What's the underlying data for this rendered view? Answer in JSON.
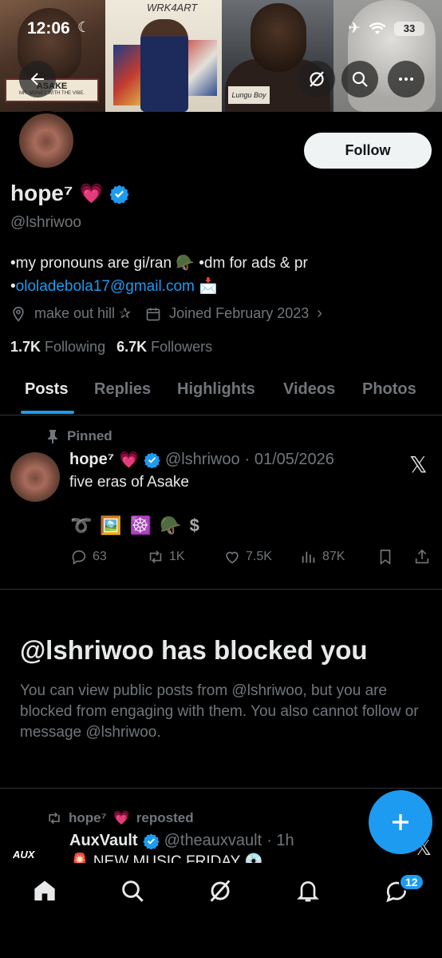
{
  "status_bar": {
    "time": "12:06",
    "battery": "33"
  },
  "banner": {
    "panel_texts": {
      "sign_line1": "ASAKE",
      "sign_line2": "MR. MONEY WITH THE VIBE.",
      "wall_text": "WRK4ART",
      "card_text": "Lungu Boy"
    }
  },
  "profile": {
    "display_name": "hope⁷",
    "name_emoji": "💗",
    "handle": "@lshriwoo",
    "follow_label": "Follow",
    "bio_line1": "•my pronouns are gi/ran 🪖 •dm for ads & pr",
    "bio_line2_prefix": "•",
    "bio_email": "ololadebola17@gmail.com",
    "bio_email_emoji": "📩",
    "location": "make out hill ✰",
    "joined": "Joined February 2023",
    "following_count": "1.7K",
    "following_label": "Following",
    "followers_count": "6.7K",
    "followers_label": "Followers"
  },
  "tabs": [
    {
      "label": "Posts",
      "active": true
    },
    {
      "label": "Replies",
      "active": false
    },
    {
      "label": "Highlights",
      "active": false
    },
    {
      "label": "Videos",
      "active": false
    },
    {
      "label": "Photos",
      "active": false
    }
  ],
  "pinned_post": {
    "pinned_label": "Pinned",
    "author_name": "hope⁷",
    "author_emoji": "💗",
    "author_handle": "@lshriwoo",
    "date": "· 01/05/2026",
    "text": "five eras of Asake",
    "emojis": [
      "➰",
      "🖼️",
      "☸️",
      "🪖",
      "$"
    ],
    "replies": "63",
    "reposts": "1K",
    "likes": "7.5K",
    "views": "87K"
  },
  "blocked": {
    "title": "@lshriwoo has blocked you",
    "message": "You can view public posts from @lshriwoo, but you are blocked from engaging with them. You also cannot follow or message @lshriwoo."
  },
  "repost": {
    "repost_label_name": "hope⁷",
    "repost_label_emoji": "💗",
    "repost_label_suffix": "reposted",
    "author_name": "AuxVault",
    "author_handle": "@theauxvault",
    "time": "· 1h",
    "avatar_text": "AUX",
    "text": "🚨 NEW MUSIC FRIDAY 💿"
  },
  "bottom_nav": {
    "messages_badge": "12"
  },
  "colors": {
    "accent": "#1d9bf0",
    "background": "#000000",
    "text": "#e7e9ea",
    "muted": "#71767b",
    "heart": "#ff4fa3"
  }
}
